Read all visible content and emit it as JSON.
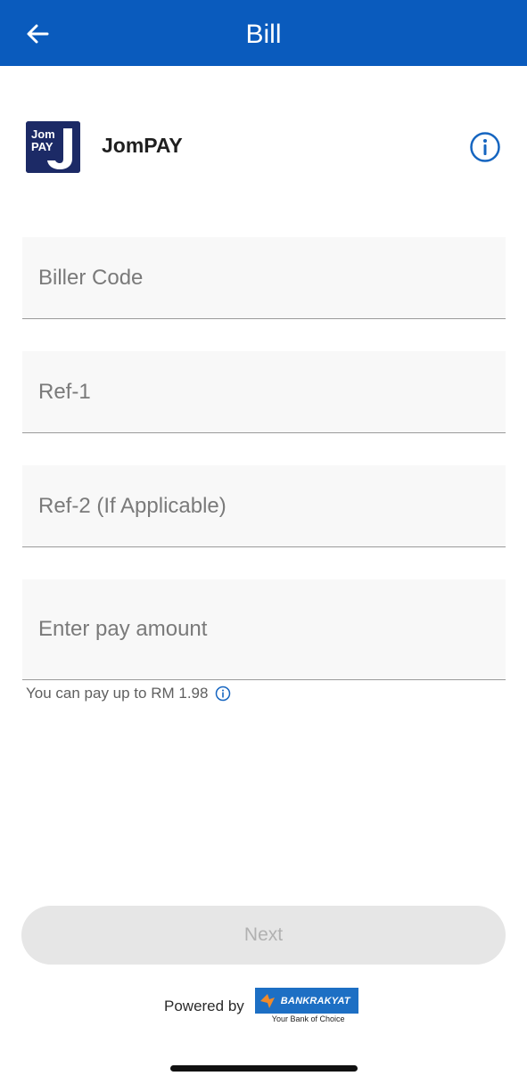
{
  "header": {
    "title": "Bill",
    "back_icon": "arrow-left-icon",
    "background": "#0a5bbd"
  },
  "biller": {
    "logo_line1": "Jom",
    "logo_line2": "PAY",
    "logo_letter": "J",
    "name": "JomPAY",
    "info_icon": "info-circle-icon"
  },
  "form": {
    "biller_code_placeholder": "Biller Code",
    "ref1_placeholder": "Ref-1",
    "ref2_placeholder": "Ref-2 (If Applicable)",
    "amount_placeholder": "Enter pay amount",
    "helper_text": "You can pay up to RM 1.98"
  },
  "actions": {
    "next_label": "Next"
  },
  "footer": {
    "powered_by": "Powered by",
    "bank_name": "BANKRAKYAT",
    "bank_tagline": "Your Bank of Choice"
  },
  "colors": {
    "primary": "#0a5bbd",
    "info_blue": "#1565c0",
    "disabled_button": "#e6e6e6",
    "disabled_text": "#b1b1b1"
  }
}
